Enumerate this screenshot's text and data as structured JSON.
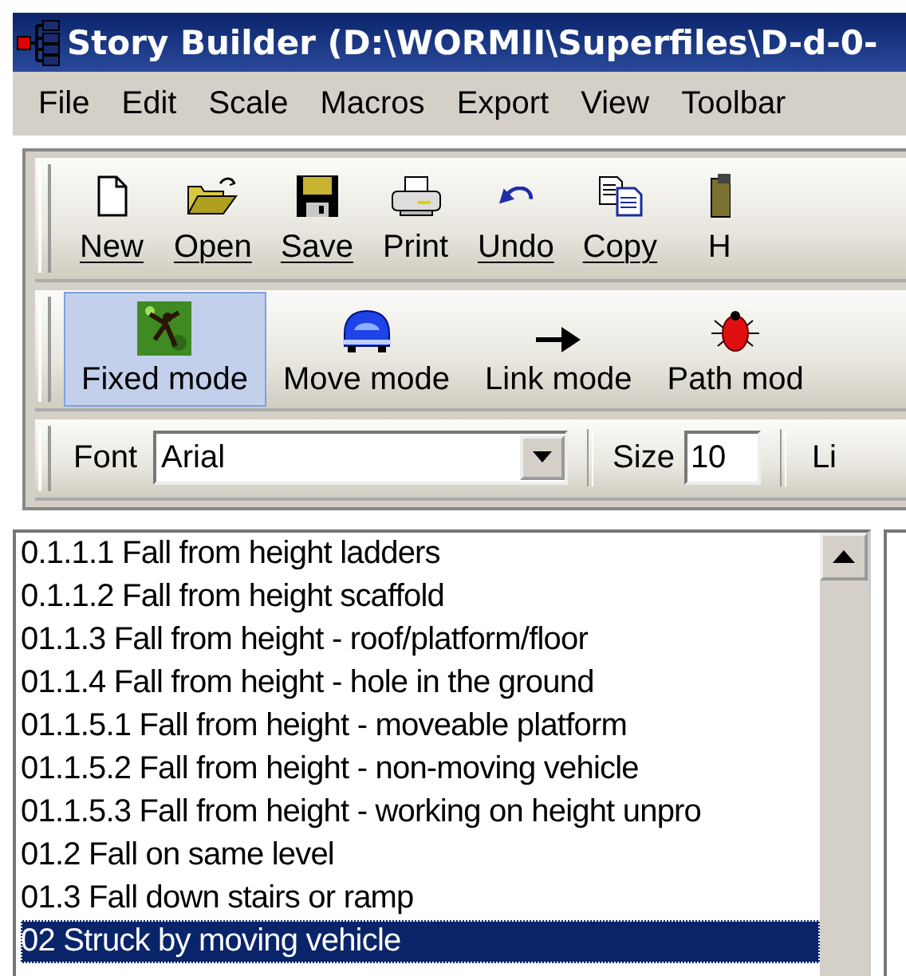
{
  "window": {
    "title": "Story Builder (D:\\WORMII\\Superfiles\\D-d-0-"
  },
  "menu": [
    "File",
    "Edit",
    "Scale",
    "Macros",
    "Export",
    "View",
    "Toolbar"
  ],
  "toolbar": [
    {
      "label": "New",
      "mnemonic": true
    },
    {
      "label": "Open",
      "mnemonic": true
    },
    {
      "label": "Save",
      "mnemonic": true
    },
    {
      "label": "Print",
      "mnemonic": false
    },
    {
      "label": "Undo",
      "mnemonic": true
    },
    {
      "label": "Copy",
      "mnemonic": true
    },
    {
      "label": "H",
      "mnemonic": false
    }
  ],
  "modes": [
    {
      "label": "Fixed mode",
      "selected": true
    },
    {
      "label": "Move mode",
      "selected": false
    },
    {
      "label": "Link mode",
      "selected": false
    },
    {
      "label": "Path mod",
      "selected": false
    }
  ],
  "format_bar": {
    "font_label": "Font",
    "font_value": "Arial",
    "size_label": "Size",
    "size_value": "10",
    "line_label": "Li"
  },
  "list": [
    {
      "text": "0.1.1.1 Fall from height ladders",
      "selected": false
    },
    {
      "text": "0.1.1.2 Fall from height scaffold",
      "selected": false
    },
    {
      "text": "01.1.3 Fall from height - roof/platform/floor",
      "selected": false
    },
    {
      "text": "01.1.4 Fall from height - hole in the ground",
      "selected": false
    },
    {
      "text": "01.1.5.1 Fall from height - moveable platform",
      "selected": false
    },
    {
      "text": "01.1.5.2 Fall from height - non-moving vehicle",
      "selected": false
    },
    {
      "text": "01.1.5.3 Fall from height - working on height unpro",
      "selected": false
    },
    {
      "text": "01.2 Fall on same level",
      "selected": false
    },
    {
      "text": "01.3 Fall down stairs or ramp",
      "selected": false
    },
    {
      "text": "02 Struck by moving vehicle",
      "selected": true
    }
  ]
}
